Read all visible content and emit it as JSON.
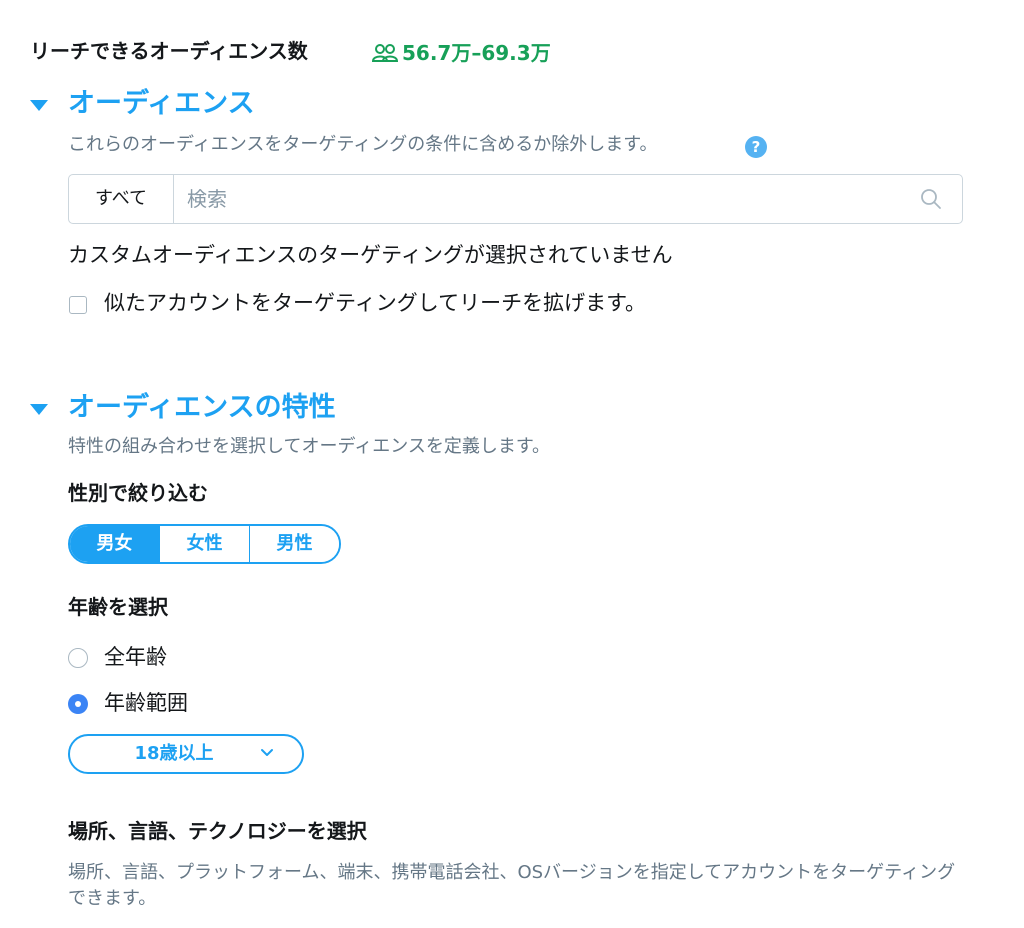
{
  "reach": {
    "label": "リーチできるオーディエンス数",
    "icon": "people-icon",
    "value": "56.7万–69.3万",
    "color": "#17a058"
  },
  "audience": {
    "title": "オーディエンス",
    "description": "これらのオーディエンスをターゲティングの条件に含めるか除外します。",
    "help_icon": "?",
    "search": {
      "scope_label": "すべて",
      "placeholder": "検索",
      "value": ""
    },
    "status_text": "カスタムオーディエンスのターゲティングが選択されていません",
    "lookalike_label": "似たアカウントをターゲティングしてリーチを拡げます。",
    "lookalike_checked": false
  },
  "characteristics": {
    "title": "オーディエンスの特性",
    "description": "特性の組み合わせを選択してオーディエンスを定義します。",
    "gender": {
      "heading": "性別で絞り込む",
      "options": [
        "男女",
        "女性",
        "男性"
      ],
      "selected": "男女"
    },
    "age": {
      "heading": "年齢を選択",
      "options": [
        {
          "label": "全年齢",
          "checked": false
        },
        {
          "label": "年齢範囲",
          "checked": true
        }
      ],
      "range_value": "18歳以上"
    },
    "location": {
      "heading": "場所、言語、テクノロジーを選択",
      "description": "場所、言語、プラットフォーム、端末、携帯電話会社、OSバージョンを指定してアカウントをターゲティングできます。"
    }
  },
  "colors": {
    "accent": "#1da1f2",
    "reach_green": "#17a058",
    "muted_text": "#657786",
    "radio_checked": "#3b84f5"
  }
}
